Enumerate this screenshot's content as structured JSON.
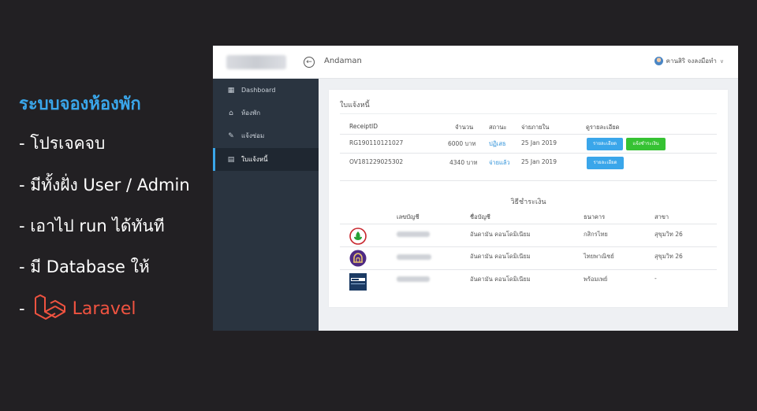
{
  "promo": {
    "title": "ระบบจองห้องพัก",
    "items": [
      "- โปรเจคจบ",
      "- มีทั้งฝั่ง User / Admin",
      "- เอาไป run ได้ทันที",
      "- มี Database ให้"
    ],
    "laravel_prefix": "-",
    "laravel_label": "Laravel",
    "laravel_color": "#f05340",
    "title_color": "#3aa6ea"
  },
  "app": {
    "topbar": {
      "title": "Andaman",
      "user_name": "คานสิริ จงลงมือทำ",
      "back_icon": "arrow-left-circle-icon",
      "chevron_icon": "chevron-down-icon"
    },
    "sidebar": {
      "items": [
        {
          "label": "Dashboard",
          "icon": "dashboard-icon",
          "glyph": "▦"
        },
        {
          "label": "ห้องพัก",
          "icon": "home-icon",
          "glyph": "⌂"
        },
        {
          "label": "แจ้งซ่อม",
          "icon": "repair-icon",
          "glyph": "✎"
        },
        {
          "label": "ใบแจ้งหนี้",
          "icon": "invoice-icon",
          "glyph": "▤",
          "active": true
        }
      ]
    },
    "invoice": {
      "title": "ใบแจ้งหนี้",
      "headers": [
        "ReceiptID",
        "จำนวน",
        "สถานะ",
        "จ่ายภายใน",
        "ดูรายละเอียด"
      ],
      "rows": [
        {
          "id": "RG190110121027",
          "amount": "6000 บาท",
          "status": "ปฏิเสธ",
          "due": "25 Jan 2019",
          "detail_btn": "รายละเอียด",
          "pay_btn": "แจ้งชำระเงิน"
        },
        {
          "id": "OV181229025302",
          "amount": "4340 บาท",
          "status": "จ่ายแล้ว",
          "due": "25 Jan 2019",
          "detail_btn": "รายละเอียด"
        }
      ]
    },
    "payment": {
      "title": "วิธีชำระเงิน",
      "headers": [
        "เลขบัญชี",
        "ชื่อบัญชี",
        "ธนาคาร",
        "สาขา"
      ],
      "rows": [
        {
          "logo": "kasikorn-logo-icon",
          "account_name": "อันดามัน คอนโดมิเนียม",
          "bank": "กสิกรไทย",
          "branch": "สุขุมวิท 26"
        },
        {
          "logo": "scb-logo-icon",
          "account_name": "อันดามัน คอนโดมิเนียม",
          "bank": "ไทยพาณิชย์",
          "branch": "สุขุมวิท 26"
        },
        {
          "logo": "promptpay-logo-icon",
          "account_name": "อันดามัน คอนโดมิเนียม",
          "bank": "พร้อมเพย์",
          "branch": "-"
        }
      ]
    },
    "colors": {
      "sidebar_bg": "#2a3440",
      "accent_blue": "#3aa6ea",
      "success_green": "#36c233",
      "link_blue": "#2a8fd8"
    }
  }
}
